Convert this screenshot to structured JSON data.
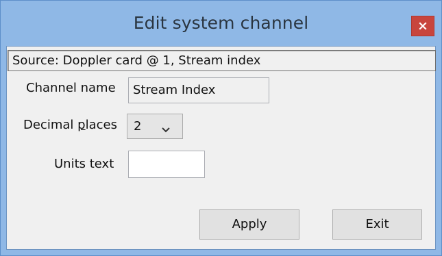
{
  "window": {
    "title": "Edit system channel",
    "close_icon": "close-icon"
  },
  "source": {
    "text": "Source: Doppler card @ 1, Stream index"
  },
  "channel_name": {
    "label": "Channel name",
    "value": "Stream Index"
  },
  "decimal_places": {
    "label_pre": "Decimal ",
    "label_underlined": "p",
    "label_post": "laces",
    "selected": "2",
    "arrow_icon": "chevron-down-icon"
  },
  "units_text": {
    "label": "Units text",
    "value": ""
  },
  "buttons": {
    "apply_label": "Apply",
    "exit_label": "Exit"
  },
  "colors": {
    "frame": "#8fb8e6",
    "close_button": "#c8453d",
    "client_background": "#f0f0f0"
  }
}
